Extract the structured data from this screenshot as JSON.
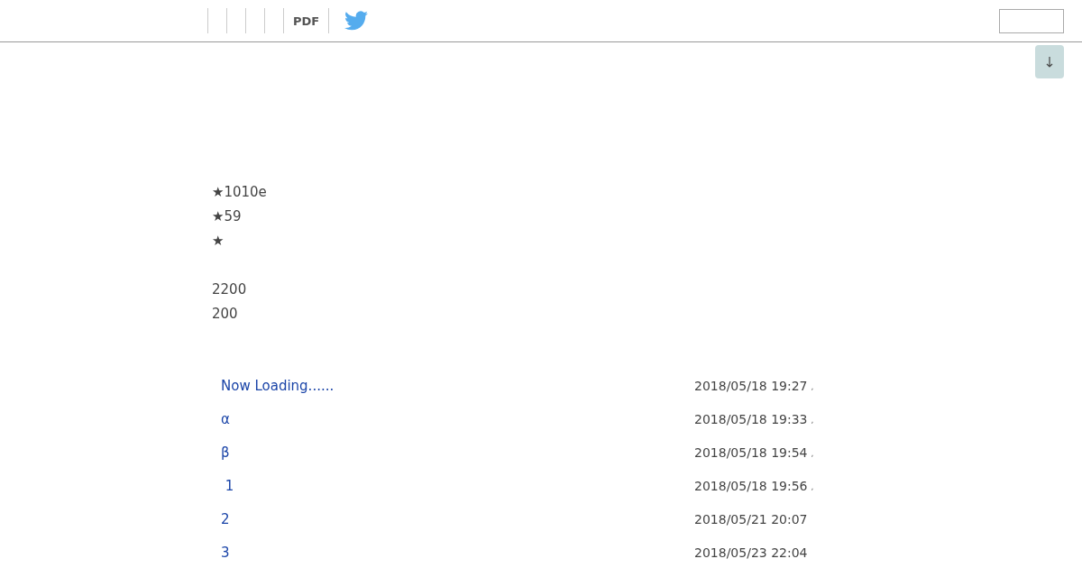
{
  "toolbar": {
    "pdf_label": "PDF"
  },
  "info_groups": [
    [
      "★1010e",
      "★59",
      "★"
    ],
    [
      "2200",
      "200"
    ]
  ],
  "entries": [
    {
      "title": "Now Loading......",
      "date": "2018/05/18 19:27",
      "mark": ","
    },
    {
      "title": "α",
      "date": "2018/05/18 19:33",
      "mark": ","
    },
    {
      "title": "β",
      "date": "2018/05/18 19:54",
      "mark": ","
    },
    {
      "title": " 1",
      "date": "2018/05/18 19:56",
      "mark": ","
    },
    {
      "title": "2",
      "date": "2018/05/21 20:07"
    },
    {
      "title": "3",
      "date": "2018/05/23 22:04"
    }
  ]
}
